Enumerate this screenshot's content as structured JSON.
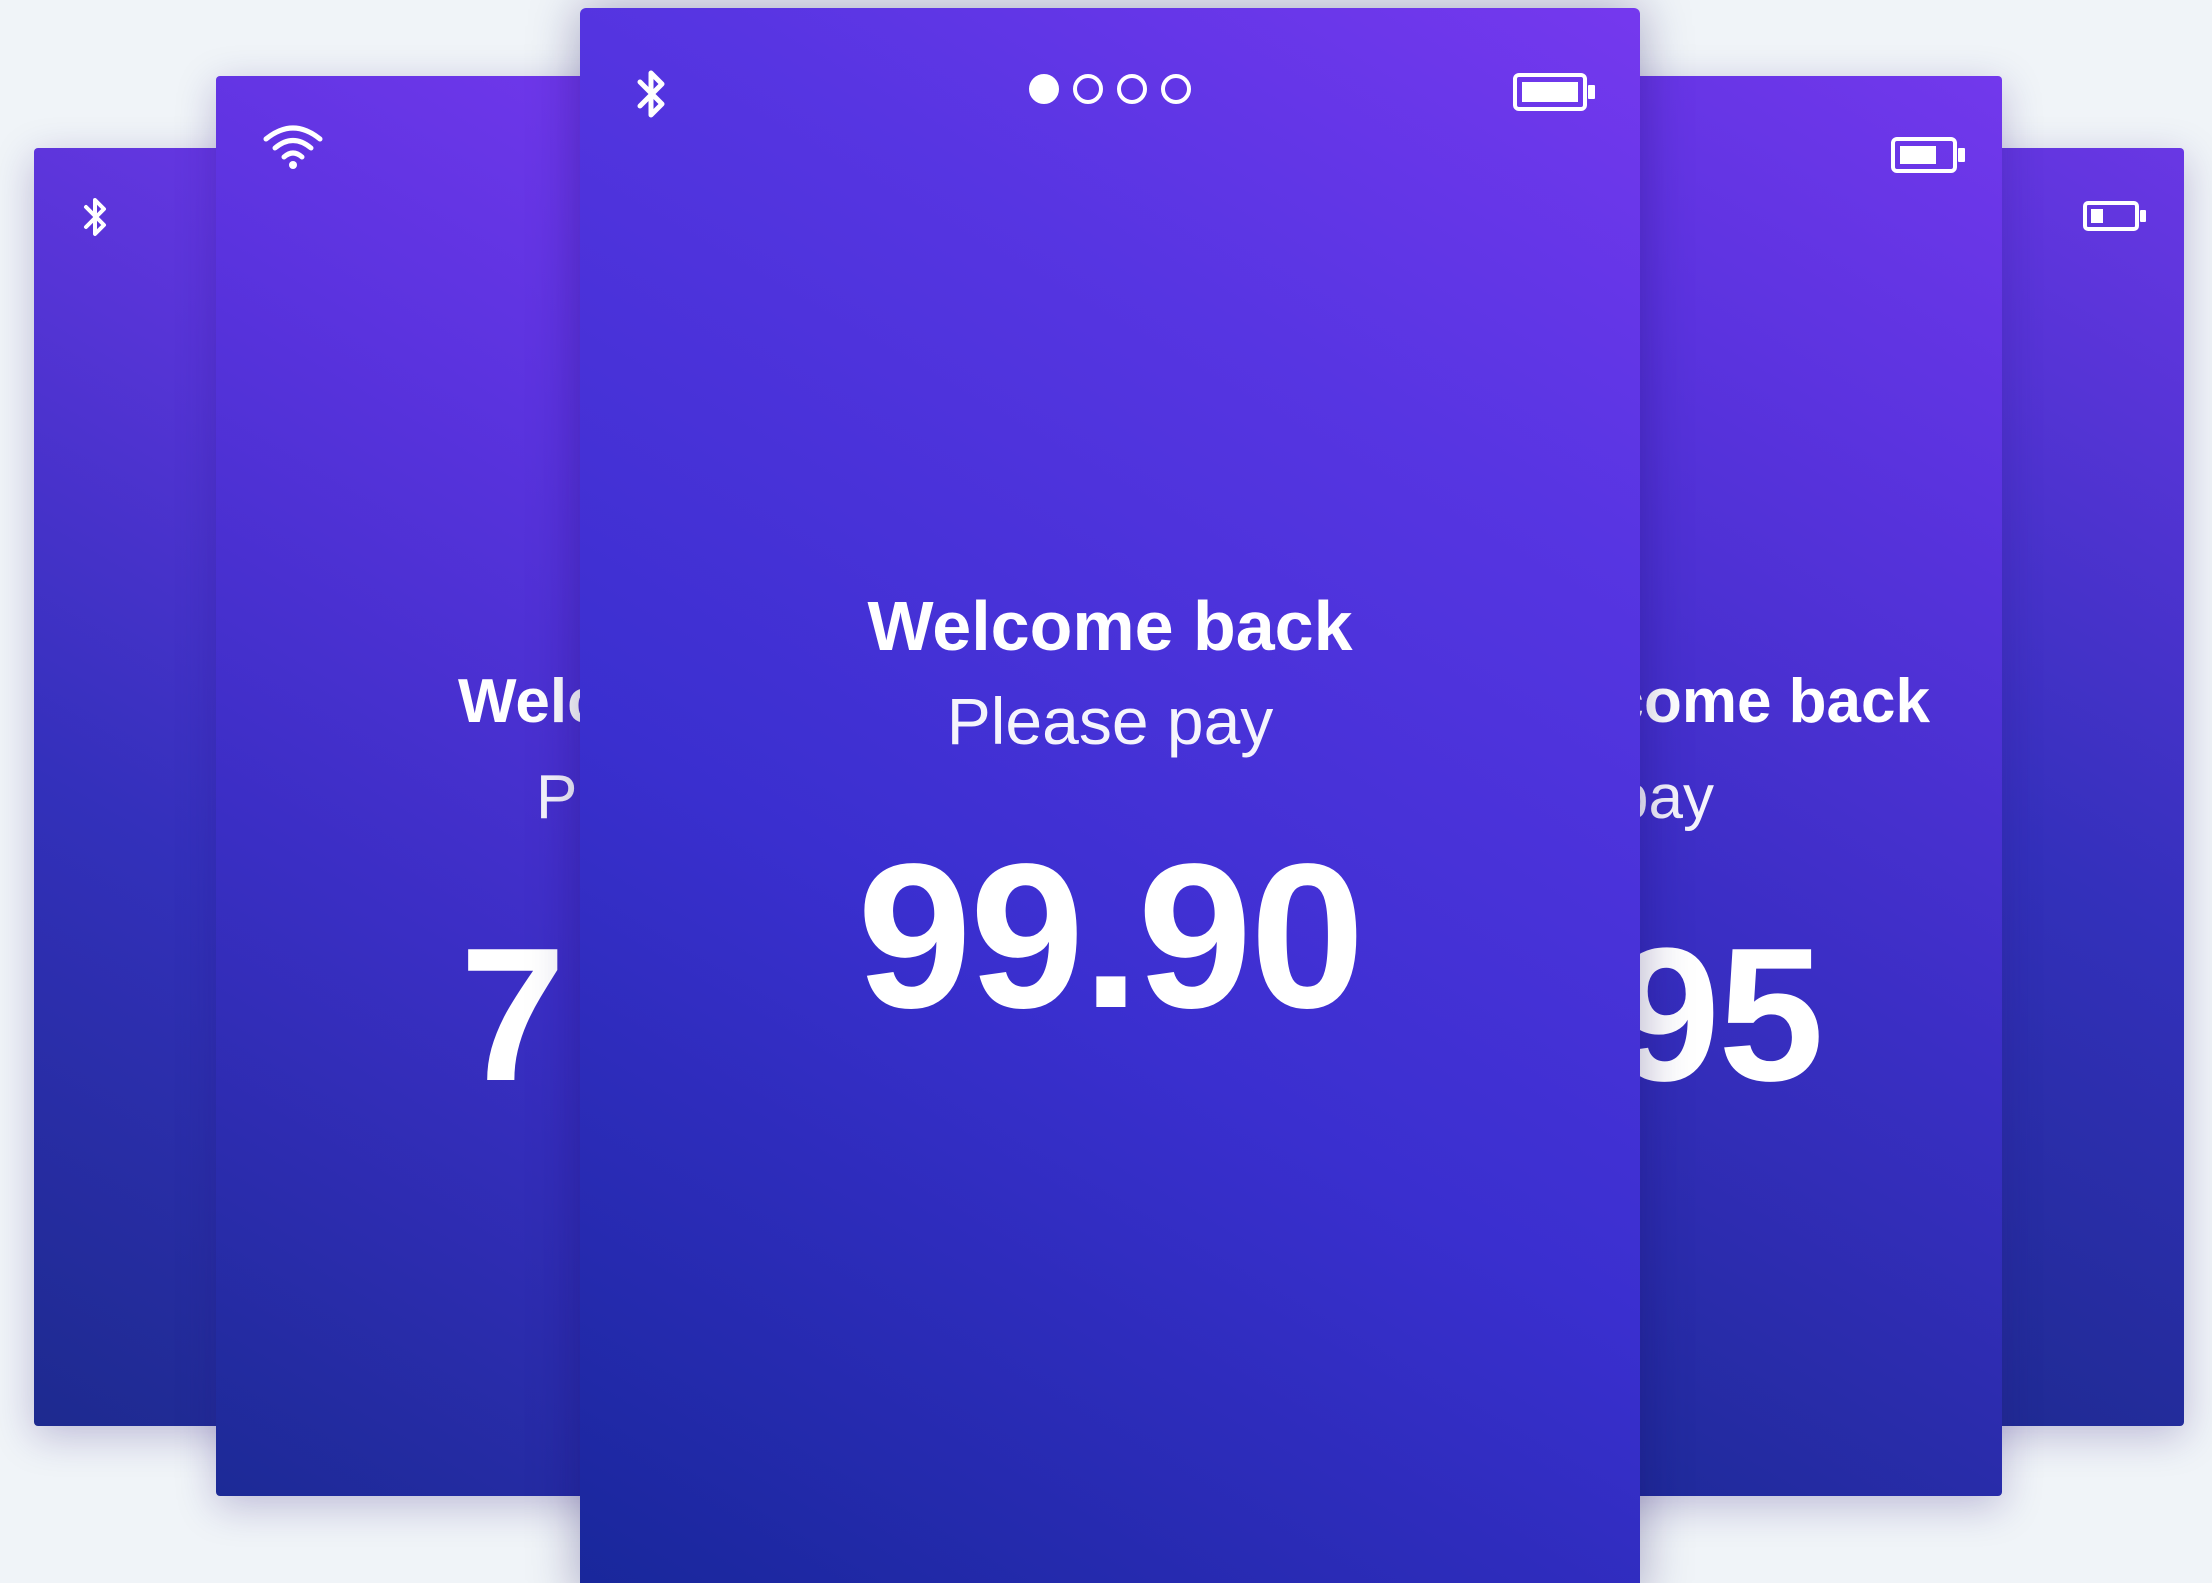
{
  "cards": {
    "far_left": {
      "status_icon": "bluetooth-icon"
    },
    "left": {
      "status_icon": "wifi-icon",
      "welcome": "Welcome back",
      "subtitle": "Please pay",
      "amount": "7"
    },
    "center": {
      "status_icons": [
        "bluetooth-icon",
        "battery-full-icon"
      ],
      "page_indicator": {
        "total": 4,
        "active": 1
      },
      "welcome": "Welcome back",
      "subtitle": "Please pay",
      "amount": "99.90"
    },
    "right": {
      "status_icon": "battery-medium-icon",
      "welcome": "Welcome back",
      "subtitle": "Please pay",
      "amount": "95"
    },
    "far_right": {
      "status_icon": "battery-low-icon"
    }
  },
  "colors": {
    "background": "#f0f4f8",
    "card_gradient_start": "#18279a",
    "card_gradient_end": "#7538ee",
    "text": "#ffffff"
  }
}
